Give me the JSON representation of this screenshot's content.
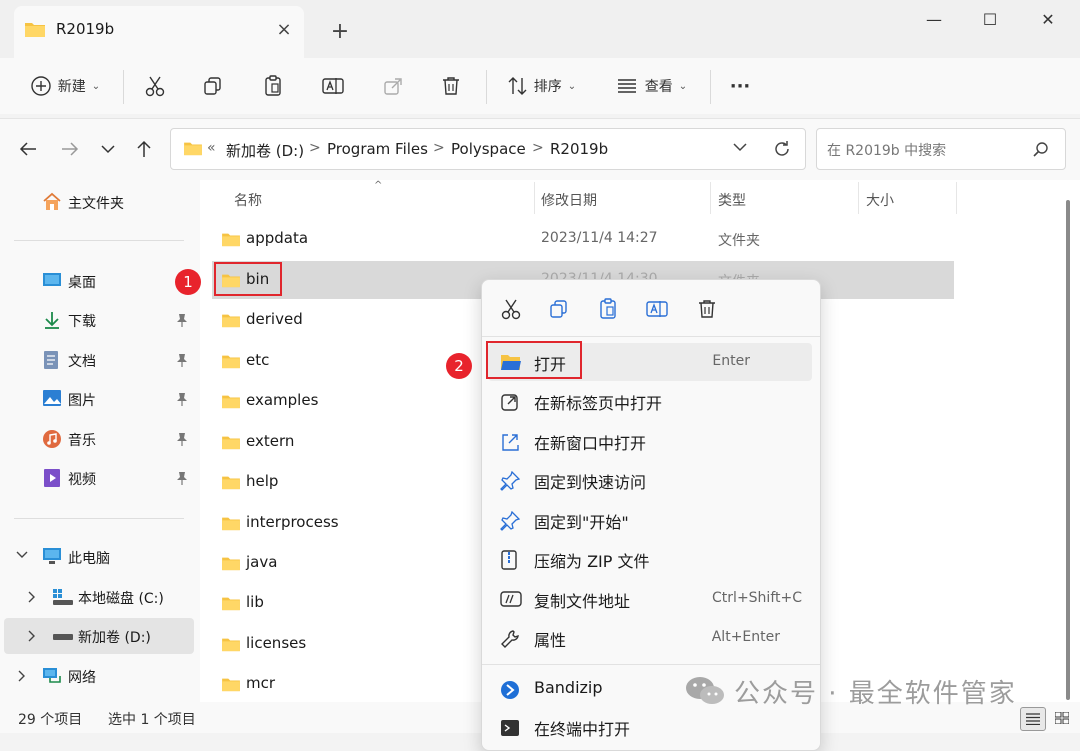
{
  "window": {
    "tab_title": "R2019b",
    "close_tab": "×",
    "new_tab": "+",
    "minimize": "—",
    "maximize": "☐",
    "close": "✕"
  },
  "toolbar": {
    "new_label": "新建",
    "sort_label": "排序",
    "view_label": "查看",
    "more_label": "···"
  },
  "address": {
    "prefix": "«",
    "crumbs": [
      "新加卷 (D:)",
      "Program Files",
      "Polyspace",
      "R2019b"
    ],
    "separator": ">",
    "search_placeholder": "在 R2019b 中搜索"
  },
  "sidebar": {
    "home": "主文件夹",
    "quick": [
      {
        "label": "桌面",
        "icon": "desktop-icon"
      },
      {
        "label": "下载",
        "icon": "download-icon"
      },
      {
        "label": "文档",
        "icon": "document-icon"
      },
      {
        "label": "图片",
        "icon": "pictures-icon"
      },
      {
        "label": "音乐",
        "icon": "music-icon"
      },
      {
        "label": "视频",
        "icon": "video-icon"
      }
    ],
    "this_pc": "此电脑",
    "drives": [
      "本地磁盘 (C:)",
      "新加卷 (D:)"
    ],
    "network": "网络"
  },
  "columns": {
    "name": "名称",
    "modified": "修改日期",
    "type": "类型",
    "size": "大小"
  },
  "files": [
    {
      "name": "appdata",
      "date": "2023/11/4 14:27",
      "type": "文件夹"
    },
    {
      "name": "bin",
      "date": "2023/11/4 14:30",
      "type": "文件夹"
    },
    {
      "name": "derived",
      "date": "",
      "type": ""
    },
    {
      "name": "etc",
      "date": "",
      "type": ""
    },
    {
      "name": "examples",
      "date": "",
      "type": ""
    },
    {
      "name": "extern",
      "date": "",
      "type": ""
    },
    {
      "name": "help",
      "date": "",
      "type": ""
    },
    {
      "name": "interprocess",
      "date": "",
      "type": ""
    },
    {
      "name": "java",
      "date": "",
      "type": ""
    },
    {
      "name": "lib",
      "date": "",
      "type": ""
    },
    {
      "name": "licenses",
      "date": "",
      "type": ""
    },
    {
      "name": "mcr",
      "date": "",
      "type": ""
    }
  ],
  "context_menu": {
    "items": [
      {
        "label": "打开",
        "shortcut": "Enter"
      },
      {
        "label": "在新标签页中打开",
        "shortcut": ""
      },
      {
        "label": "在新窗口中打开",
        "shortcut": ""
      },
      {
        "label": "固定到快速访问",
        "shortcut": ""
      },
      {
        "label": "固定到\"开始\"",
        "shortcut": ""
      },
      {
        "label": "压缩为 ZIP 文件",
        "shortcut": ""
      },
      {
        "label": "复制文件地址",
        "shortcut": "Ctrl+Shift+C"
      },
      {
        "label": "属性",
        "shortcut": "Alt+Enter"
      },
      {
        "label": "Bandizip",
        "shortcut": ""
      },
      {
        "label": "在终端中打开",
        "shortcut": ""
      }
    ]
  },
  "annotations": {
    "step1": "1",
    "step2": "2"
  },
  "status": {
    "count": "29 个项目",
    "selected": "选中 1 个项目"
  },
  "watermark": "公众号 · 最全软件管家",
  "colors": {
    "accent": "#0067c0",
    "folder": "#f6c343",
    "annotation_red": "#e0262d"
  }
}
